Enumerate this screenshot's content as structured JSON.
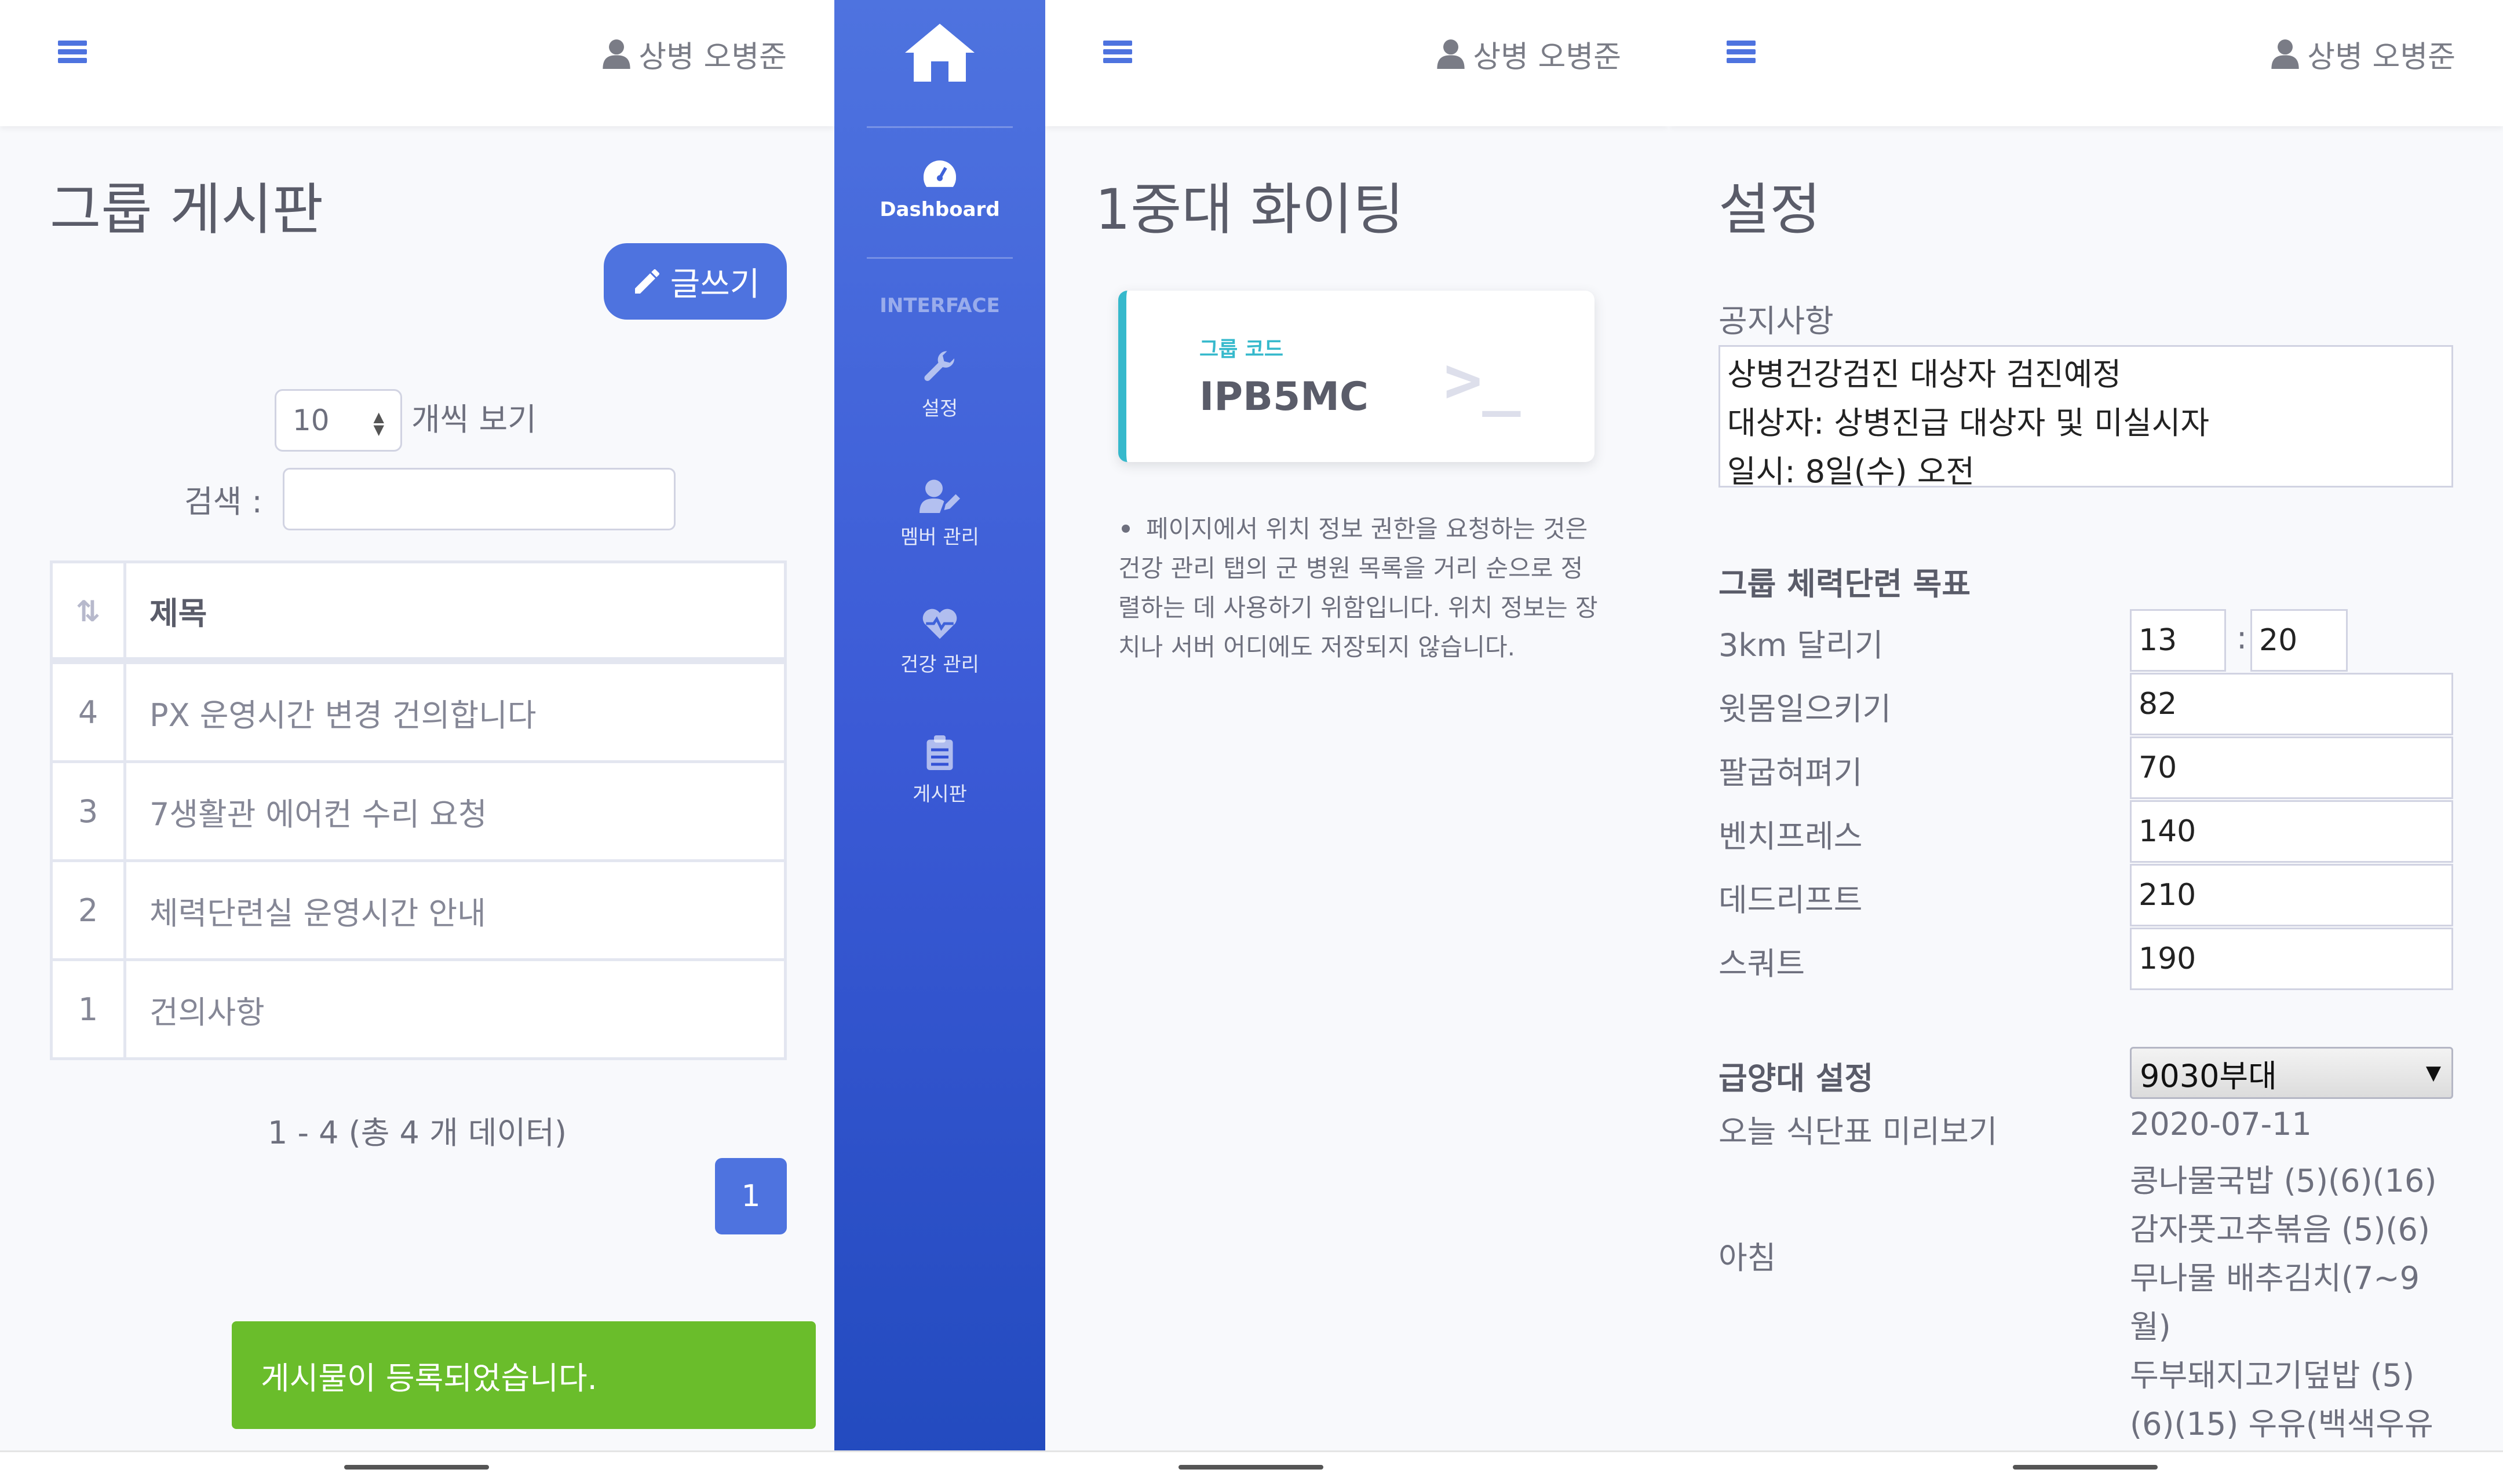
{
  "user": {
    "name": "상병 오병준"
  },
  "board": {
    "title": "그룹 게시판",
    "write_label": "글쓰기",
    "page_size": "10",
    "page_size_suffix": "개씩 보기",
    "search_label": "검색 :",
    "search_value": "",
    "columns": [
      "",
      "제목"
    ],
    "rows": [
      {
        "num": "4",
        "title": "PX 운영시간 변경 건의합니다"
      },
      {
        "num": "3",
        "title": "7생활관 에어컨 수리 요청"
      },
      {
        "num": "2",
        "title": "체력단련실 운영시간 안내"
      },
      {
        "num": "1",
        "title": "건의사항"
      }
    ],
    "info": "1 - 4 (총 4 개 데이터)",
    "current_page": "1",
    "toast": "게시물이 등록되었습니다."
  },
  "sidebar": {
    "dashboard": "Dashboard",
    "section": "INTERFACE",
    "items": [
      {
        "label": "설정",
        "icon": "wrench-icon"
      },
      {
        "label": "멤버 관리",
        "icon": "user-edit-icon"
      },
      {
        "label": "건강 관리",
        "icon": "heartbeat-icon"
      },
      {
        "label": "게시판",
        "icon": "clipboard-list-icon"
      }
    ]
  },
  "group": {
    "title": "1중대 화이팅",
    "code_label": "그룹 코드",
    "code": "IPB5MC",
    "notice": "페이지에서 위치 정보 권한을 요청하는 것은 건강 관리 탭의 군 병원 목록을 거리 순으로 정렬하는 데 사용하기 위함입니다. 위치 정보는 장치나 서버 어디에도 저장되지 않습니다."
  },
  "settings": {
    "title": "설정",
    "notice_label": "공지사항",
    "notice_lines": [
      "상병건강검진 대상자 검진예정",
      "대상자: 상병진급 대상자 및 미실시자",
      "일시: 8일(수) 오전"
    ],
    "fitness_heading": "그룹 체력단련 목표",
    "run_label": "3km 달리기",
    "run_min": "13",
    "run_sep": ":",
    "run_sec": "20",
    "situps_label": "윗몸일으키기",
    "situps": "82",
    "pushups_label": "팔굽혀펴기",
    "pushups": "70",
    "bench_label": "벤치프레스",
    "bench": "140",
    "deadlift_label": "데드리프트",
    "deadlift": "210",
    "squat_label": "스쿼트",
    "squat": "190",
    "mess_heading": "급양대 설정",
    "mess_unit": "9030부대",
    "preview_label": "오늘 식단표 미리보기",
    "date": "2020-07-11",
    "breakfast_label": "아침",
    "breakfast_items": [
      "콩나물국밥 (5)(6)(16)",
      "감자풋고추볶음 (5)(6)",
      "무나물 배추김치(7~9",
      "월)",
      "두부돼지고기덮밥 (5)",
      "(6)(15) 우유(백색우유"
    ]
  },
  "colors": {
    "primary": "#4e73df",
    "info": "#36b9cc",
    "success": "#6abd2b"
  }
}
